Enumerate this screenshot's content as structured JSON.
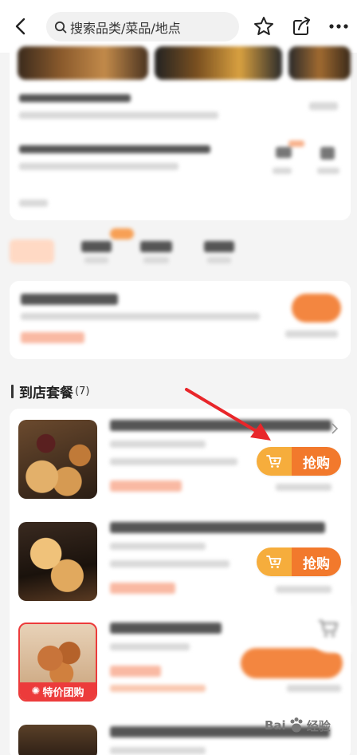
{
  "header": {
    "search_placeholder": "搜索品类/菜品/地点",
    "icons": [
      "back-icon",
      "search-icon",
      "star-icon",
      "share-icon",
      "more-icon"
    ]
  },
  "section": {
    "title": "到店套餐",
    "count": "(7)"
  },
  "deals": [
    {
      "buy_label": "抢购"
    },
    {
      "buy_label": "抢购"
    },
    {
      "badge": "特价团购"
    }
  ],
  "watermark": {
    "text": "Bai",
    "text2": "经验"
  },
  "colors": {
    "accent": "#f2792c",
    "accent_light": "#f6ad3c",
    "badge_red": "#ec3b3b",
    "arrow_red": "#e8262a"
  }
}
